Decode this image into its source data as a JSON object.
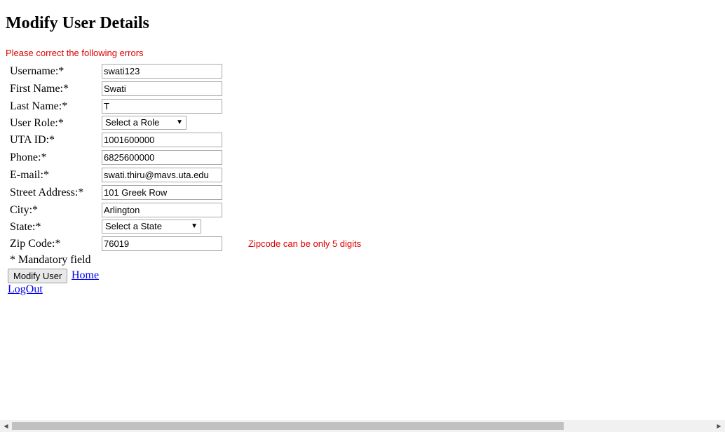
{
  "page": {
    "title": "Modify User Details",
    "error_summary": "Please correct the following errors"
  },
  "form": {
    "username": {
      "label": "Username:*",
      "value": "swati123"
    },
    "first_name": {
      "label": "First Name:*",
      "value": "Swati"
    },
    "last_name": {
      "label": "Last Name:*",
      "value": "T"
    },
    "user_role": {
      "label": "User Role:*",
      "selected": "Select a Role"
    },
    "uta_id": {
      "label": "UTA ID:*",
      "value": "1001600000"
    },
    "phone": {
      "label": "Phone:*",
      "value": "6825600000"
    },
    "email": {
      "label": "E-mail:*",
      "value": "swati.thiru@mavs.uta.edu"
    },
    "street_address": {
      "label": "Street Address:*",
      "value": "101 Greek Row"
    },
    "city": {
      "label": "City:*",
      "value": "Arlington"
    },
    "state": {
      "label": "State:*",
      "selected": "Select a State"
    },
    "zip_code": {
      "label": "Zip Code:*",
      "value": "76019",
      "error": "Zipcode can be only 5 digits"
    },
    "mandatory_note": "* Mandatory field",
    "submit_label": "Modify User"
  },
  "links": {
    "home": "Home",
    "logout": "LogOut"
  },
  "icons": {
    "dropdown": "chevron-down-icon",
    "scroll_left": "arrow-left-icon",
    "scroll_right": "arrow-right-icon"
  },
  "colors": {
    "error_text": "#e00000",
    "link": "#0000ee"
  }
}
